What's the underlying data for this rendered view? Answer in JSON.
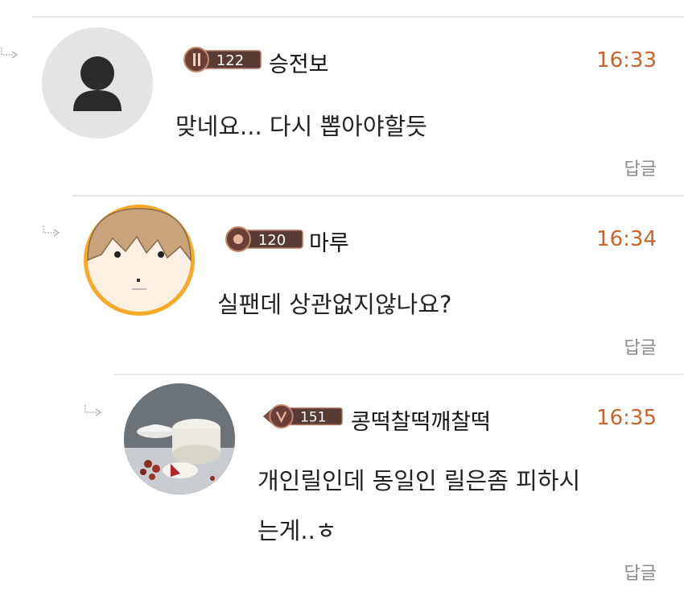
{
  "comments": [
    {
      "nickname": "승전보",
      "level": "122",
      "time": "16:33",
      "text_lines": [
        "맞네요... 다시 뽑아야할듯"
      ],
      "reply_label": "답글",
      "avatar": "default-person-icon"
    },
    {
      "nickname": "마루",
      "level": "120",
      "time": "16:34",
      "text_lines": [
        "실팬데 상관없지않나요?"
      ],
      "reply_label": "답글",
      "avatar": "cartoon-face-avatar"
    },
    {
      "nickname": "콩떡찰떡깨찰떡",
      "level": "151",
      "time": "16:35",
      "text_lines": [
        "개인릴인데 동일인 릴은좀 피하시",
        "는게..ㅎ"
      ],
      "reply_label": "답글",
      "avatar": "rice-cake-photo-avatar"
    }
  ],
  "colors": {
    "time": "#c8642c",
    "reply": "#8a8a8a",
    "divider": "#e6e6e6",
    "badge_bg": "#5a3a34"
  }
}
